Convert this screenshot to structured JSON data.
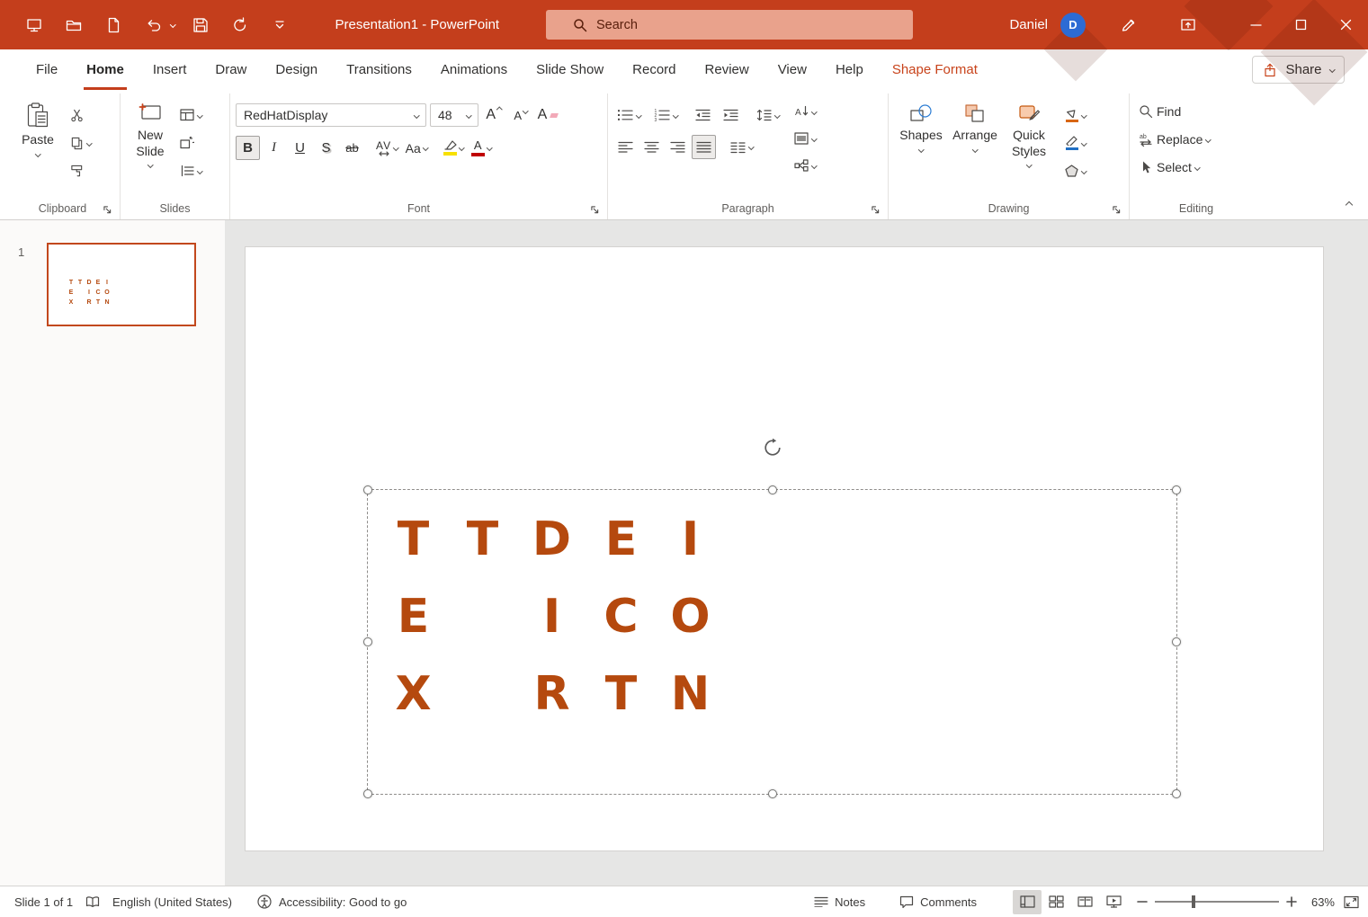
{
  "titlebar": {
    "title": "Presentation1 - PowerPoint",
    "search_placeholder": "Search",
    "user_name": "Daniel",
    "user_initial": "D"
  },
  "ribbon_tabs": [
    {
      "label": "File"
    },
    {
      "label": "Home"
    },
    {
      "label": "Insert"
    },
    {
      "label": "Draw"
    },
    {
      "label": "Design"
    },
    {
      "label": "Transitions"
    },
    {
      "label": "Animations"
    },
    {
      "label": "Slide Show"
    },
    {
      "label": "Record"
    },
    {
      "label": "Review"
    },
    {
      "label": "View"
    },
    {
      "label": "Help"
    },
    {
      "label": "Shape Format"
    }
  ],
  "share": {
    "label": "Share"
  },
  "ribbon": {
    "clipboard": {
      "group_label": "Clipboard",
      "paste_label": "Paste"
    },
    "slides": {
      "group_label": "Slides",
      "new_slide_label": "New Slide"
    },
    "font": {
      "group_label": "Font",
      "font_name": "RedHatDisplay",
      "font_size": "48",
      "grow_font_letter": "A",
      "shrink_font_letter": "A",
      "clear_format_letter": "A",
      "bold": "B",
      "italic": "I",
      "underline": "U",
      "shadow": "S",
      "strikethrough": "ab",
      "char_spacing": "AV",
      "change_case": "Aa",
      "font_color_letter": "A"
    },
    "paragraph": {
      "group_label": "Paragraph"
    },
    "drawing": {
      "group_label": "Drawing",
      "shapes_label": "Shapes",
      "arrange_label": "Arrange",
      "quick_styles_label": "Quick Styles"
    },
    "editing": {
      "group_label": "Editing",
      "find_label": "Find",
      "replace_label": "Replace",
      "select_label": "Select"
    }
  },
  "slide_panel": {
    "slide_number": "1"
  },
  "slide": {
    "letter_rows": [
      [
        "T",
        "T",
        "D",
        "E",
        "I"
      ],
      [
        "E",
        "",
        "I",
        "C",
        "O"
      ],
      [
        "X",
        "",
        "R",
        "T",
        "N"
      ]
    ],
    "text_color": "#B5490E"
  },
  "statusbar": {
    "slide_info": "Slide 1 of 1",
    "language": "English (United States)",
    "accessibility": "Accessibility: Good to go",
    "notes_label": "Notes",
    "comments_label": "Comments",
    "zoom_level": "63%"
  },
  "colors": {
    "titlebar_bg": "#C43E1C",
    "search_bg": "#E9A28C",
    "accent": "#C43E1C",
    "contextual_tab": "#C8431B",
    "avatar_bg": "#2D6BD4",
    "slide_text": "#B5490E",
    "thumbnail_border": "#C2481D",
    "font_color_bar": "#C00000",
    "highlight_bar": "#F7E000"
  }
}
